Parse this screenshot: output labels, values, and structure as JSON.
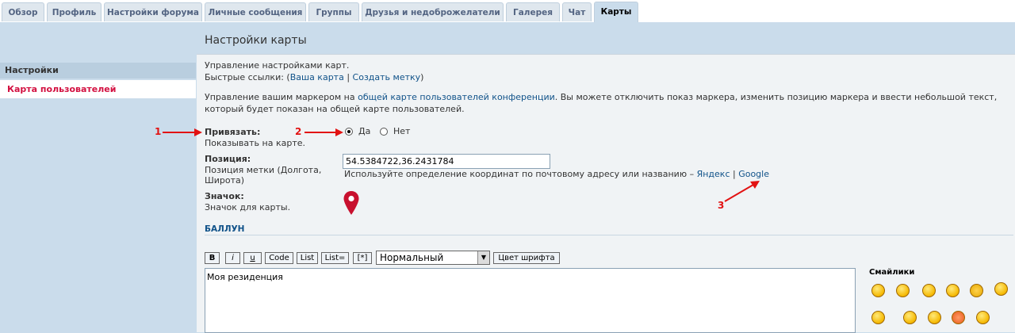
{
  "tabs": [
    {
      "label": "Обзор",
      "active": false
    },
    {
      "label": "Профиль",
      "active": false
    },
    {
      "label": "Настройки форума",
      "active": false
    },
    {
      "label": "Личные сообщения",
      "active": false
    },
    {
      "label": "Группы",
      "active": false
    },
    {
      "label": "Друзья и недоброжелатели",
      "active": false
    },
    {
      "label": "Галерея",
      "active": false
    },
    {
      "label": "Чат",
      "active": false
    },
    {
      "label": "Карты",
      "active": true
    }
  ],
  "sidebar": {
    "heading": "Настройки",
    "active_item": "Карта пользователей"
  },
  "page": {
    "title": "Настройки карты",
    "intro_line1": "Управление настройками карт.",
    "quick_links_prefix": "Быстрые ссылки: (",
    "quick_link_map": "Ваша карта",
    "quick_links_sep": " | ",
    "quick_link_create": "Создать метку",
    "quick_links_suffix": ")",
    "desc_part1": "Управление вашим маркером на ",
    "desc_link": "общей карте пользователей конференции",
    "desc_part2": ". Вы можете отключить показ маркера, изменить позицию маркера и ввести небольшой текст,",
    "desc_line2": "который будет показан на общей карте пользователей."
  },
  "form": {
    "bind_label": "Привязать:",
    "bind_hint": "Показывать на карте.",
    "bind_options": {
      "yes": "Да",
      "no": "Нет",
      "selected": "yes"
    },
    "position_label": "Позиция:",
    "position_hint_line1": "Позиция метки (Долгота,",
    "position_hint_line2": "Широта)",
    "position_value": "54.5384722,36.2431784",
    "geocode_text": "Используйте определение координат по почтовому адресу или названию – ",
    "geocode_yandex": "Яндекс",
    "geocode_sep": " | ",
    "geocode_google": "Google",
    "icon_label": "Значок:",
    "icon_hint": "Значок для карты.",
    "icon_name": "map-pin-icon",
    "marker_color": "#c8102e"
  },
  "balloon": {
    "heading": "БАЛЛУН",
    "buttons": [
      "B",
      "i",
      "u",
      "Code",
      "List",
      "List=",
      "[*]"
    ],
    "font_size_selected": "Нормальный",
    "font_color_button": "Цвет шрифта",
    "text": "Моя резиденция"
  },
  "smilies": {
    "title": "Смайлики",
    "icons": [
      "grin-smiley-icon",
      "smile-smiley-icon",
      "surprised-smiley-icon",
      "laugh-smiley-icon",
      "shout-smiley-icon",
      "shocked-smiley-icon",
      "sad-smiley-icon",
      "cool-smiley-icon",
      "confused-smiley-icon",
      "angry-smiley-icon",
      "evil-smiley-icon"
    ]
  },
  "annotations": [
    "1",
    "2",
    "3"
  ],
  "colors": {
    "annotation": "#e21212",
    "active_link": "#d31141",
    "link": "#105289"
  }
}
